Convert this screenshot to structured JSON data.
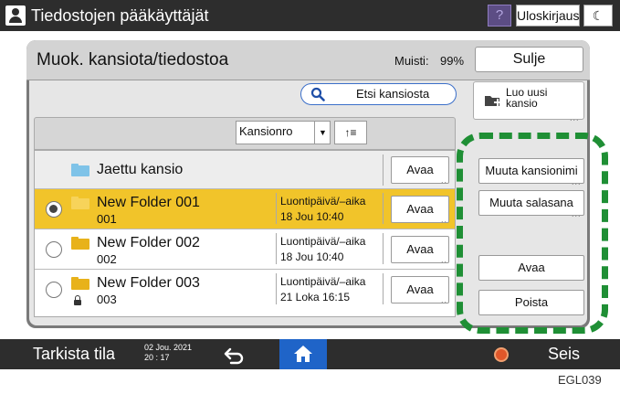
{
  "topbar": {
    "title": "Tiedostojen pääkäyttäjät",
    "help_label": "?",
    "logout_label": "Uloskirjaus",
    "night_label": "☾"
  },
  "dialog": {
    "title": "Muok. kansiota/tiedostoa",
    "memory_label": "Muisti:",
    "memory_value": "99%",
    "close_label": "Sulje",
    "search_label": "Etsi kansiosta",
    "new_folder_label": "Luo uusi kansio",
    "sort_label": "Kansionro",
    "sort_order_label": "↑≡"
  },
  "shared_folder": {
    "name": "Jaettu kansio",
    "open_label": "Avaa"
  },
  "folders": [
    {
      "name": "New Folder 001",
      "number": "001",
      "date_label": "Luontipäivä/–aika",
      "date": "18 Jou   10:40",
      "open_label": "Avaa",
      "selected": true,
      "locked": false
    },
    {
      "name": "New Folder 002",
      "number": "002",
      "date_label": "Luontipäivä/–aika",
      "date": "18 Jou   10:40",
      "open_label": "Avaa",
      "selected": false,
      "locked": false
    },
    {
      "name": "New Folder 003",
      "number": "003",
      "date_label": "Luontipäivä/–aika",
      "date": "21 Loka  16:15",
      "open_label": "Avaa",
      "selected": false,
      "locked": true
    }
  ],
  "actions": {
    "rename_folder": "Muuta kansionimi",
    "change_password": "Muuta salasana",
    "open": "Avaa",
    "delete": "Poista"
  },
  "bottombar": {
    "check_status": "Tarkista tila",
    "date": "02 Jou. 2021",
    "time": "20 : 17",
    "stop_label": "Seis"
  },
  "figure_code": "EGL039",
  "colors": {
    "selected_row": "#f1c42a",
    "folder_yellow": "#e8b21a",
    "shared_folder_blue": "#7fc3e8",
    "highlight_green": "#1f8f35",
    "home_blue": "#1f64c8"
  },
  "icons": {
    "search": "magnifier-icon",
    "home": "home-icon",
    "back": "back-arrow-icon"
  }
}
